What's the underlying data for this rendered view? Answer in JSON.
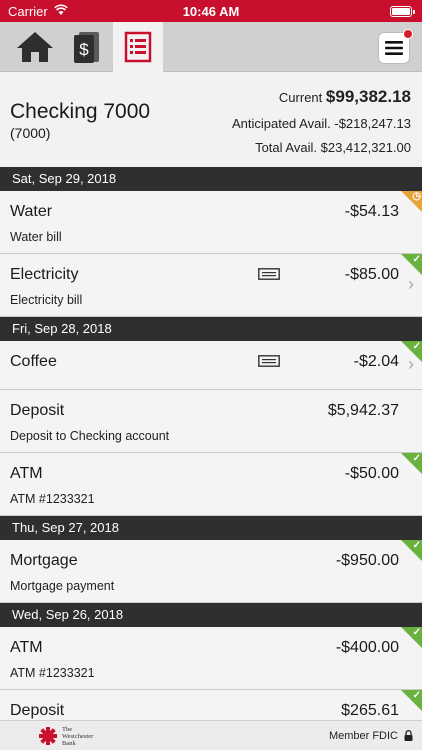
{
  "status_bar": {
    "carrier": "Carrier",
    "time": "10:46 AM"
  },
  "nav": {
    "tabs": [
      {
        "name": "home-icon"
      },
      {
        "name": "money-icon"
      },
      {
        "name": "statement-icon",
        "active": true
      }
    ],
    "menu_badge_color": "#d81e2c"
  },
  "account": {
    "name": "Checking 7000",
    "number": "(7000)",
    "current_label": "Current",
    "current_value": "$99,382.18",
    "anticipated_label": "Anticipated Avail.",
    "anticipated_value": "-$218,247.13",
    "total_label": "Total Avail.",
    "total_value": "$23,412,321.00"
  },
  "groups": [
    {
      "date": "Sat, Sep 29, 2018",
      "items": [
        {
          "title": "Water",
          "desc": "Water bill",
          "amount": "-$54.13",
          "status": "pending",
          "receipt": false,
          "chevron": false
        },
        {
          "title": "Electricity",
          "desc": "Electricity bill",
          "amount": "-$85.00",
          "status": "cleared",
          "receipt": true,
          "chevron": true
        }
      ]
    },
    {
      "date": "Fri, Sep 28, 2018",
      "items": [
        {
          "title": "Coffee",
          "desc": "",
          "amount": "-$2.04",
          "status": "cleared",
          "receipt": true,
          "chevron": true
        },
        {
          "title": "Deposit",
          "desc": "Deposit to Checking account",
          "amount": "$5,942.37",
          "status": "none",
          "receipt": false,
          "chevron": false
        },
        {
          "title": "ATM",
          "desc": "ATM #1233321",
          "amount": "-$50.00",
          "status": "cleared",
          "receipt": false,
          "chevron": false
        }
      ]
    },
    {
      "date": "Thu, Sep 27, 2018",
      "items": [
        {
          "title": "Mortgage",
          "desc": "Mortgage payment",
          "amount": "-$950.00",
          "status": "cleared",
          "receipt": false,
          "chevron": false
        }
      ]
    },
    {
      "date": "Wed, Sep 26, 2018",
      "items": [
        {
          "title": "ATM",
          "desc": "ATM #1233321",
          "amount": "-$400.00",
          "status": "cleared",
          "receipt": false,
          "chevron": false
        },
        {
          "title": "Deposit",
          "desc": "",
          "amount": "$265.61",
          "status": "cleared",
          "receipt": false,
          "chevron": false
        }
      ]
    }
  ],
  "footer": {
    "bank_line1": "The",
    "bank_line2": "Westchester",
    "bank_line3": "Bank",
    "fdic": "Member FDIC"
  },
  "colors": {
    "brand_red": "#c8102e",
    "cleared": "#6ab23f",
    "pending": "#e8a33a",
    "header_dark": "#2f2f2f"
  }
}
